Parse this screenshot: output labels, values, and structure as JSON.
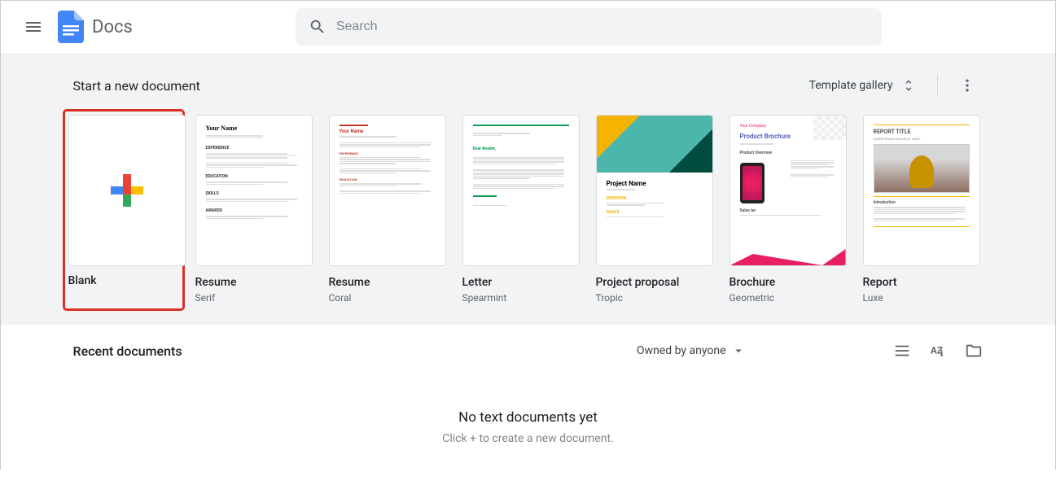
{
  "header": {
    "app_name": "Docs",
    "search_placeholder": "Search"
  },
  "templates_section": {
    "title": "Start a new document",
    "gallery_label": "Template gallery",
    "items": [
      {
        "label": "Blank",
        "sublabel": ""
      },
      {
        "label": "Resume",
        "sublabel": "Serif"
      },
      {
        "label": "Resume",
        "sublabel": "Coral"
      },
      {
        "label": "Letter",
        "sublabel": "Spearmint"
      },
      {
        "label": "Project proposal",
        "sublabel": "Tropic"
      },
      {
        "label": "Brochure",
        "sublabel": "Geometric"
      },
      {
        "label": "Report",
        "sublabel": "Luxe"
      }
    ]
  },
  "template_previews": {
    "resume_serif_name": "Your Name",
    "resume_coral_name": "Your Name",
    "project_name": "Project Name",
    "brochure_company": "Your Company",
    "brochure_title": "Product Brochure",
    "brochure_overview": "Product Overview",
    "report_title": "REPORT TITLE",
    "report_sub": "LOREM IPSUM DOLOR SIT AMET",
    "report_intro": "Introduction"
  },
  "recent": {
    "title": "Recent documents",
    "filter_label": "Owned by anyone",
    "empty_title": "No text documents yet",
    "empty_sub": "Click + to create a new document."
  }
}
